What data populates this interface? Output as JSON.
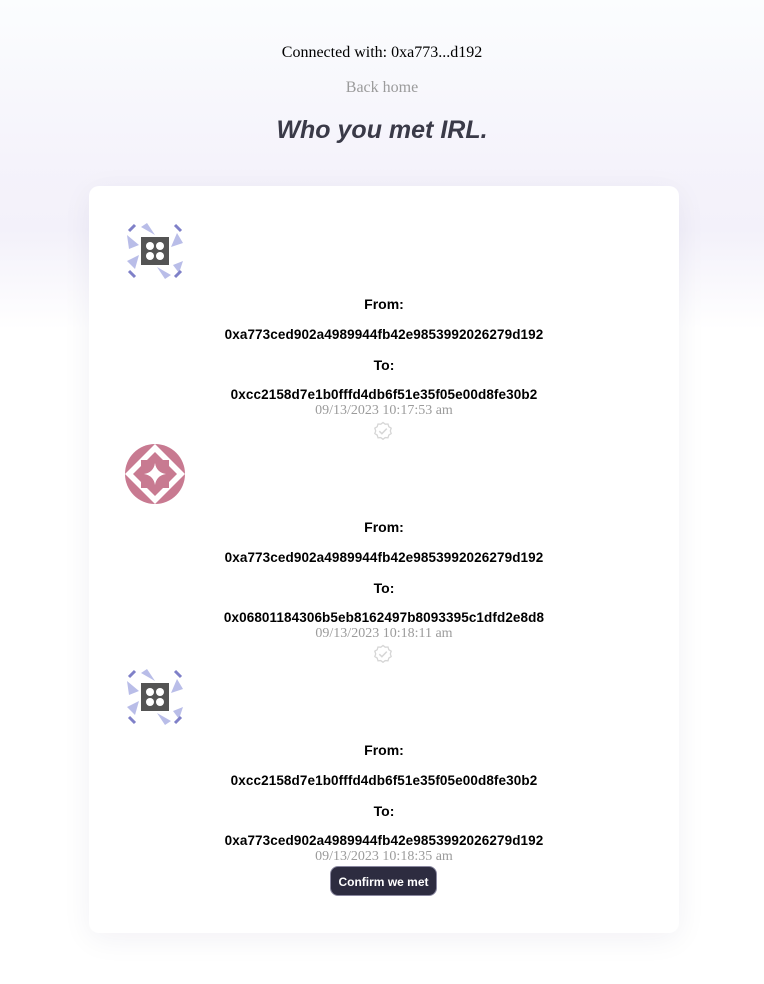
{
  "header": {
    "connected_text": "Connected with: 0xa773...d192",
    "back_home": "Back home",
    "title": "Who you met IRL."
  },
  "meetings": [
    {
      "avatar": "blue-grid-identicon",
      "from_label": "From:",
      "from_address": "0xa773ced902a4989944fb42e9853992026279d192",
      "to_label": "To:",
      "to_address": "0xcc2158d7e1b0fffd4db6f51e35f05e00d8fe30b2",
      "timestamp": "09/13/2023 10:17:53 am",
      "status_icon": "verified-check-icon"
    },
    {
      "avatar": "pink-star-identicon",
      "from_label": "From:",
      "from_address": "0xa773ced902a4989944fb42e9853992026279d192",
      "to_label": "To:",
      "to_address": "0x06801184306b5eb8162497b8093395c1dfd2e8d8",
      "timestamp": "09/13/2023 10:18:11 am",
      "status_icon": "verified-check-icon"
    },
    {
      "avatar": "blue-grid-identicon",
      "from_label": "From:",
      "from_address": "0xcc2158d7e1b0fffd4db6f51e35f05e00d8fe30b2",
      "to_label": "To:",
      "to_address": "0xa773ced902a4989944fb42e9853992026279d192",
      "timestamp": "09/13/2023 10:18:35 am",
      "action_label": "Confirm we met"
    }
  ],
  "colors": {
    "title": "#3a3a48",
    "muted": "#9b9b9b",
    "button_bg": "#2d2c40",
    "identicon_blue": "#8e8fd2",
    "identicon_pink": "#c87a91",
    "identicon_dark": "#545454"
  }
}
